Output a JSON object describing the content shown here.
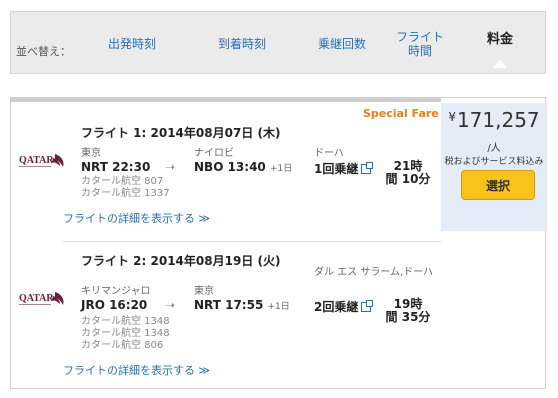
{
  "sort": {
    "label": "並べ替え：",
    "options": [
      {
        "label": "出発時刻"
      },
      {
        "label": "到着時刻"
      },
      {
        "label": "乗継回数"
      },
      {
        "label": "フライト時間"
      },
      {
        "label": "料金",
        "active": true
      }
    ]
  },
  "result": {
    "special_fare": "Special Fare",
    "price": {
      "currency": "¥",
      "amount": "171,257",
      "per_person": "/人",
      "tax_note": "税およびサービス料込み",
      "select_label": "選択"
    },
    "segments": [
      {
        "title": "フライト 1:  2014年08月07日 (木)",
        "airline_icon": "qatar-airways-logo",
        "depart_city": "東京",
        "depart_time": "NRT  22:30",
        "depart_plus": "",
        "arrive_city": "ナイロビ",
        "arrive_time": "NBO  13:40",
        "arrive_plus": "+1日",
        "via": "ドーハ",
        "stops": "1回乗継",
        "duration_h": "21時",
        "duration_m": "間 10分",
        "carrier_lines": [
          "カタール航空 807",
          "カタール航空 1337"
        ],
        "details_link": "フライトの詳細を表示する ≫"
      },
      {
        "title": "フライト 2:  2014年08月19日 (火)",
        "airline_icon": "qatar-airways-logo",
        "depart_city": "キリマンジャロ",
        "depart_time": "JRO  16:20",
        "depart_plus": "",
        "arrive_city": "東京",
        "arrive_time": "NRT  17:55",
        "arrive_plus": "+1日",
        "via": "ダル エス サラーム,ドーハ",
        "stops": "2回乗継",
        "duration_h": "19時",
        "duration_m": "間 35分",
        "carrier_lines": [
          "カタール航空 1348",
          "カタール航空 1348",
          "カタール航空 806"
        ],
        "details_link": "フライトの詳細を表示する ≫"
      }
    ]
  }
}
